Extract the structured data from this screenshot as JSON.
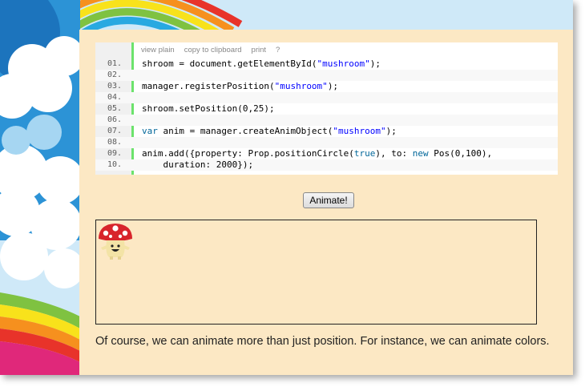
{
  "toolbar": {
    "view_plain": "view plain",
    "copy": "copy to clipboard",
    "print": "print",
    "help": "?"
  },
  "code": {
    "lines": [
      {
        "no": "01.",
        "parts": [
          [
            "",
            "shroom = document.getElementById("
          ],
          [
            "str",
            "\"mushroom\""
          ],
          [
            "",
            ");"
          ]
        ]
      },
      {
        "no": "02.",
        "parts": []
      },
      {
        "no": "03.",
        "parts": [
          [
            "",
            "manager.registerPosition("
          ],
          [
            "str",
            "\"mushroom\""
          ],
          [
            "",
            ");"
          ]
        ]
      },
      {
        "no": "04.",
        "parts": []
      },
      {
        "no": "05.",
        "parts": [
          [
            "",
            "shroom.setPosition(0,25);"
          ]
        ]
      },
      {
        "no": "06.",
        "parts": []
      },
      {
        "no": "07.",
        "parts": [
          [
            "kw",
            "var"
          ],
          [
            "",
            " anim = manager.createAnimObject("
          ],
          [
            "str",
            "\"mushroom\""
          ],
          [
            "",
            ");"
          ]
        ]
      },
      {
        "no": "08.",
        "parts": []
      },
      {
        "no": "09.",
        "parts": [
          [
            "",
            "anim.add({property: Prop.positionCircle("
          ],
          [
            "kw",
            "true"
          ],
          [
            "",
            "), to: "
          ],
          [
            "kw",
            "new"
          ],
          [
            "",
            " Pos(0,100),"
          ]
        ]
      },
      {
        "no": "10.",
        "parts": [
          [
            "",
            "    duration: 2000});"
          ]
        ]
      }
    ]
  },
  "animate_button": "Animate!",
  "paragraph": "Of course, we can animate more than just position. For instance, we can animate colors.",
  "colors": {
    "content_bg": "#fce8c4",
    "gutter_bar": "#6ce26c",
    "string": "#0000ff",
    "keyword": "#006699"
  }
}
